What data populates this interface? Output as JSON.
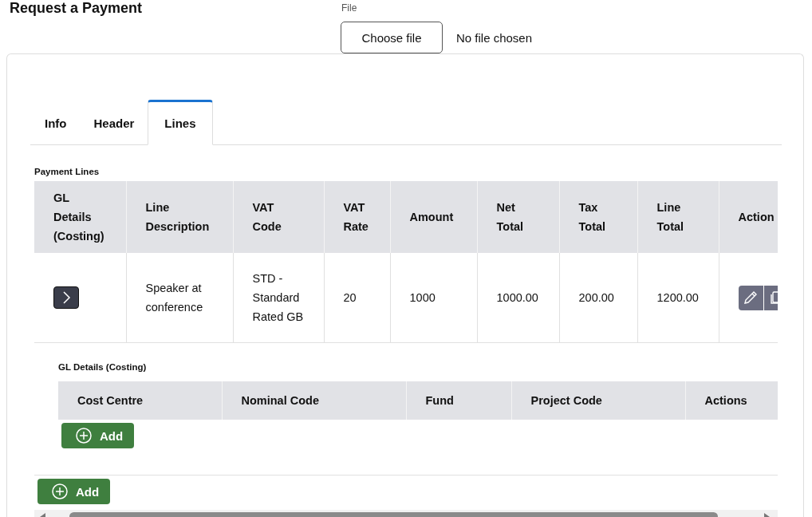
{
  "page_title": "Request a Payment",
  "file_input": {
    "label": "File",
    "button": "Choose file",
    "status": "No file chosen"
  },
  "tabs": [
    {
      "label": "Info",
      "selected": false
    },
    {
      "label": "Header",
      "selected": false
    },
    {
      "label": "Lines",
      "selected": true
    }
  ],
  "payment_lines": {
    "title": "Payment Lines",
    "columns": [
      "GL Details (Costing)",
      "Line Description",
      "VAT Code",
      "VAT Rate",
      "Amount",
      "Net Total",
      "Tax Total",
      "Line Total",
      "Action"
    ],
    "rows": [
      {
        "expanded": true,
        "description": "Speaker at conference",
        "vat_code": "STD - Standard Rated GB",
        "vat_rate": "20",
        "amount": "1000",
        "net_total": "1000.00",
        "tax_total": "200.00",
        "line_total": "1200.00",
        "gl_details": {
          "title": "GL Details (Costing)",
          "columns": [
            "Cost Centre",
            "Nominal Code",
            "Fund",
            "Project Code",
            "Actions"
          ],
          "add_button": "Add"
        }
      }
    ],
    "add_button": "Add"
  }
}
